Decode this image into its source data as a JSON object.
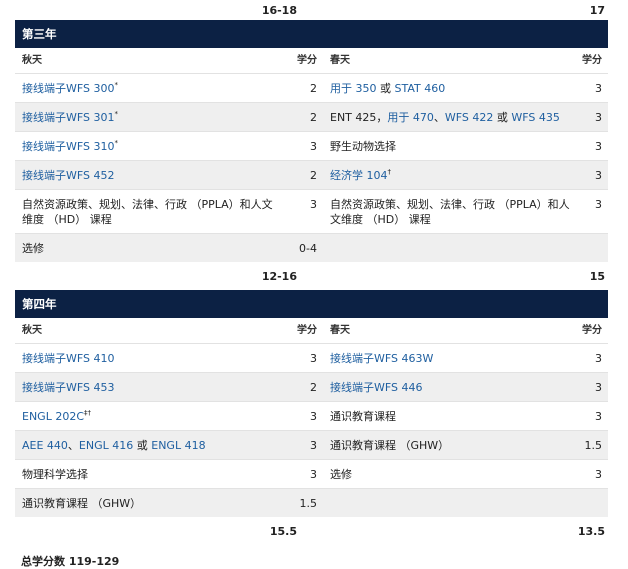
{
  "top_sum": {
    "left": "16-18",
    "right": "17"
  },
  "year3": {
    "title": "第三年",
    "fall_label": "秋天",
    "spring_label": "春天",
    "credits_label": "学分",
    "rows": [
      {
        "l": "接线端子WFS 300",
        "ls": "*",
        "lc": "2",
        "r": "用于 350 或 STAT 460",
        "rc": "3"
      },
      {
        "l": "接线端子WFS 301",
        "ls": "*",
        "lc": "2",
        "r": "ENT 425，用于 470、WFS 422 或 WFS 435",
        "rc": "3"
      },
      {
        "l": "接线端子WFS 310",
        "ls": "*",
        "lc": "3",
        "r": "野生动物选择",
        "rc": "3"
      },
      {
        "l": "接线端子WFS 452",
        "ls": "",
        "lc": "2",
        "r": "经济学 104",
        "rs": "†",
        "rc": "3"
      },
      {
        "l": "自然资源政策、规划、法律、行政 （PPLA）和人文维度 （HD） 课程",
        "lc": "3",
        "r": "自然资源政策、规划、法律、行政 （PPLA）和人文维度 （HD） 课程",
        "rc": "3"
      },
      {
        "l": "选修",
        "lc": "0-4",
        "r": "",
        "rc": ""
      }
    ],
    "sum_left": "12-16",
    "sum_right": "15"
  },
  "year4": {
    "title": "第四年",
    "fall_label": "秋天",
    "spring_label": "春天",
    "credits_label": "学分",
    "rows": [
      {
        "l": "接线端子WFS 410",
        "lc": "3",
        "r": "接线端子WFS 463W",
        "rc": "3"
      },
      {
        "l": "接线端子WFS 453",
        "lc": "2",
        "r": "接线端子WFS 446",
        "rc": "3"
      },
      {
        "l": "ENGL 202C",
        "ls": "‡†",
        "lc": "3",
        "r": "通识教育课程",
        "rc": "3"
      },
      {
        "l": "AEE 440、ENGL 416 或 ENGL 418",
        "lc": "3",
        "r": "通识教育课程 （GHW）",
        "rc": "1.5"
      },
      {
        "l": "物理科学选择",
        "lc": "3",
        "r": "选修",
        "rc": "3"
      },
      {
        "l": "通识教育课程 （GHW）",
        "lc": "1.5",
        "r": "",
        "rc": ""
      }
    ],
    "sum_left": "15.5",
    "sum_right": "13.5"
  },
  "total": "总学分数 119-129"
}
